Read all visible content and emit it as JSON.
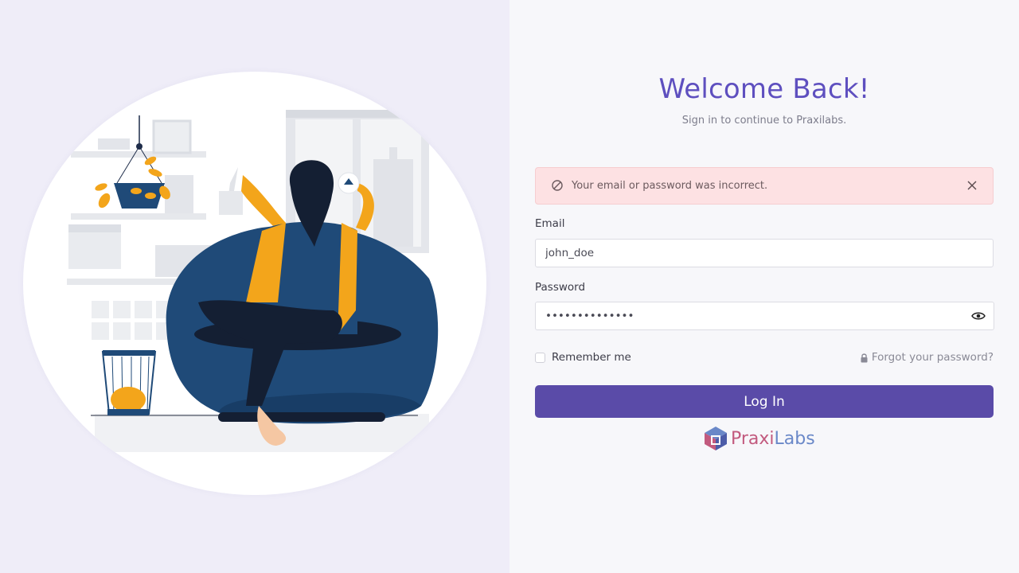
{
  "page": {
    "title": "Welcome Back!",
    "subtitle": "Sign in to continue to Praxilabs."
  },
  "alert": {
    "message": "Your email or password was incorrect.",
    "icon": "ban-icon",
    "close_icon": "close-icon"
  },
  "form": {
    "email_label": "Email",
    "email_value": "john_doe",
    "password_label": "Password",
    "password_value": "••••••••••••••",
    "show_password_icon": "eye-icon",
    "remember_label": "Remember me",
    "remember_checked": false,
    "forgot_label": "Forgot your password?",
    "forgot_icon": "lock-icon",
    "submit_label": "Log In"
  },
  "brand": {
    "name_part1": "Praxi",
    "name_part2": "Labs"
  },
  "colors": {
    "accent": "#5e4fbf",
    "button": "#5a4ba8",
    "alert_bg": "#fde1e3",
    "left_bg": "#efedf8"
  }
}
